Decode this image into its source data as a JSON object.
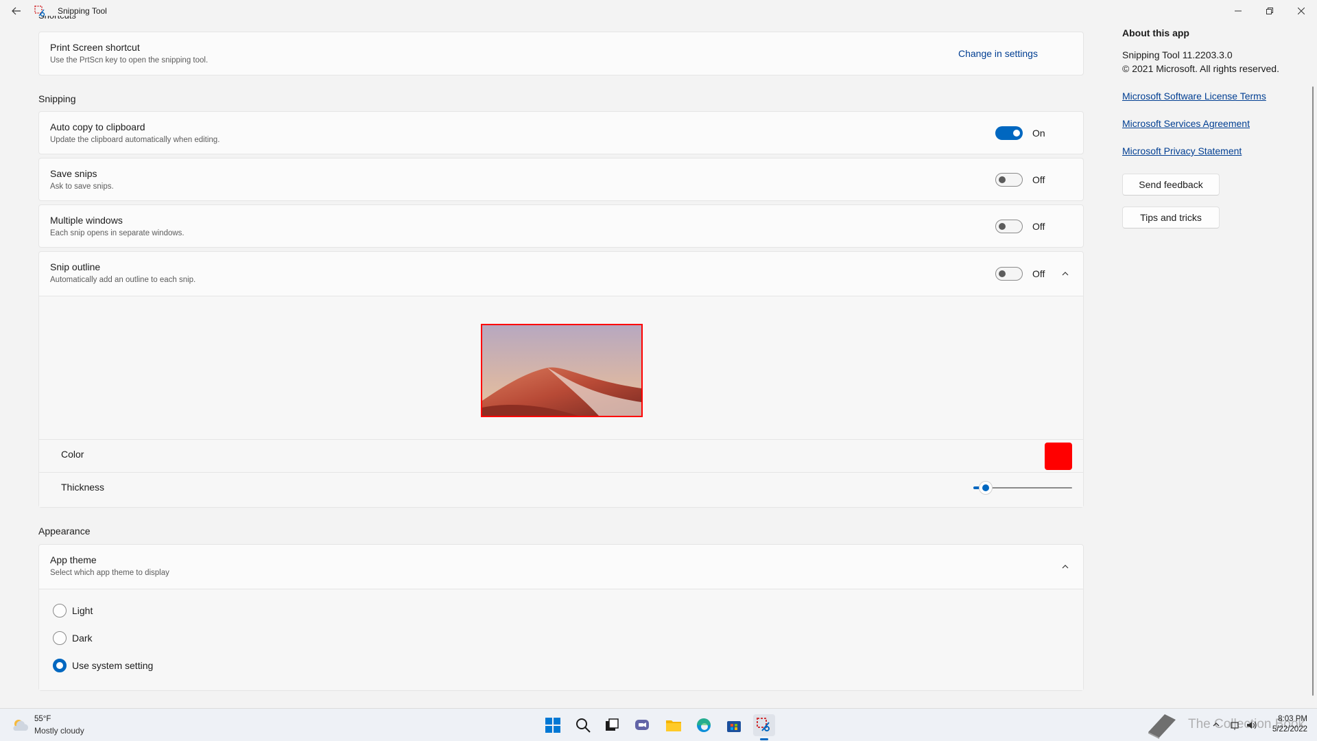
{
  "window": {
    "title": "Snipping Tool",
    "back_icon": "back-arrow-icon",
    "controls": [
      "minimize-icon",
      "restore-icon",
      "close-icon"
    ]
  },
  "shortcuts": {
    "cut_heading": "Shortcuts",
    "print_screen": {
      "title": "Print Screen shortcut",
      "desc": "Use the PrtScn key to open the snipping tool.",
      "action": "Change in settings"
    }
  },
  "snipping": {
    "heading": "Snipping",
    "items": [
      {
        "title": "Auto copy to clipboard",
        "desc": "Update the clipboard automatically when editing.",
        "state": "On"
      },
      {
        "title": "Save snips",
        "desc": "Ask to save snips.",
        "state": "Off"
      },
      {
        "title": "Multiple windows",
        "desc": "Each snip opens in separate windows.",
        "state": "Off"
      },
      {
        "title": "Snip outline",
        "desc": "Automatically add an outline to each snip.",
        "state": "Off"
      }
    ],
    "outline": {
      "color_label": "Color",
      "color_value": "#ff0000",
      "thickness_label": "Thickness",
      "thickness_fraction": 0.1
    }
  },
  "appearance": {
    "heading": "Appearance",
    "theme": {
      "title": "App theme",
      "desc": "Select which app theme to display",
      "options": [
        "Light",
        "Dark",
        "Use system setting"
      ],
      "selected": "Use system setting"
    }
  },
  "about": {
    "heading": "About this app",
    "version": "Snipping Tool 11.2203.3.0",
    "copyright": "© 2021 Microsoft. All rights reserved.",
    "links": [
      "Microsoft Software License Terms",
      "Microsoft Services Agreement",
      "Microsoft Privacy Statement"
    ],
    "buttons": [
      "Send feedback",
      "Tips and tricks"
    ]
  },
  "taskbar": {
    "weather_temp": "55°F",
    "weather_desc": "Mostly cloudy",
    "time": "8:03 PM",
    "date": "5/22/2022",
    "watermark": "The Collection Book",
    "icons": [
      "start-icon",
      "search-icon",
      "task-view-icon",
      "chat-icon",
      "file-explorer-icon",
      "edge-icon",
      "store-icon",
      "snipping-tool-icon"
    ]
  },
  "colors": {
    "accent": "#0067c0",
    "link": "#003e92",
    "outline_red": "#ff0000"
  }
}
